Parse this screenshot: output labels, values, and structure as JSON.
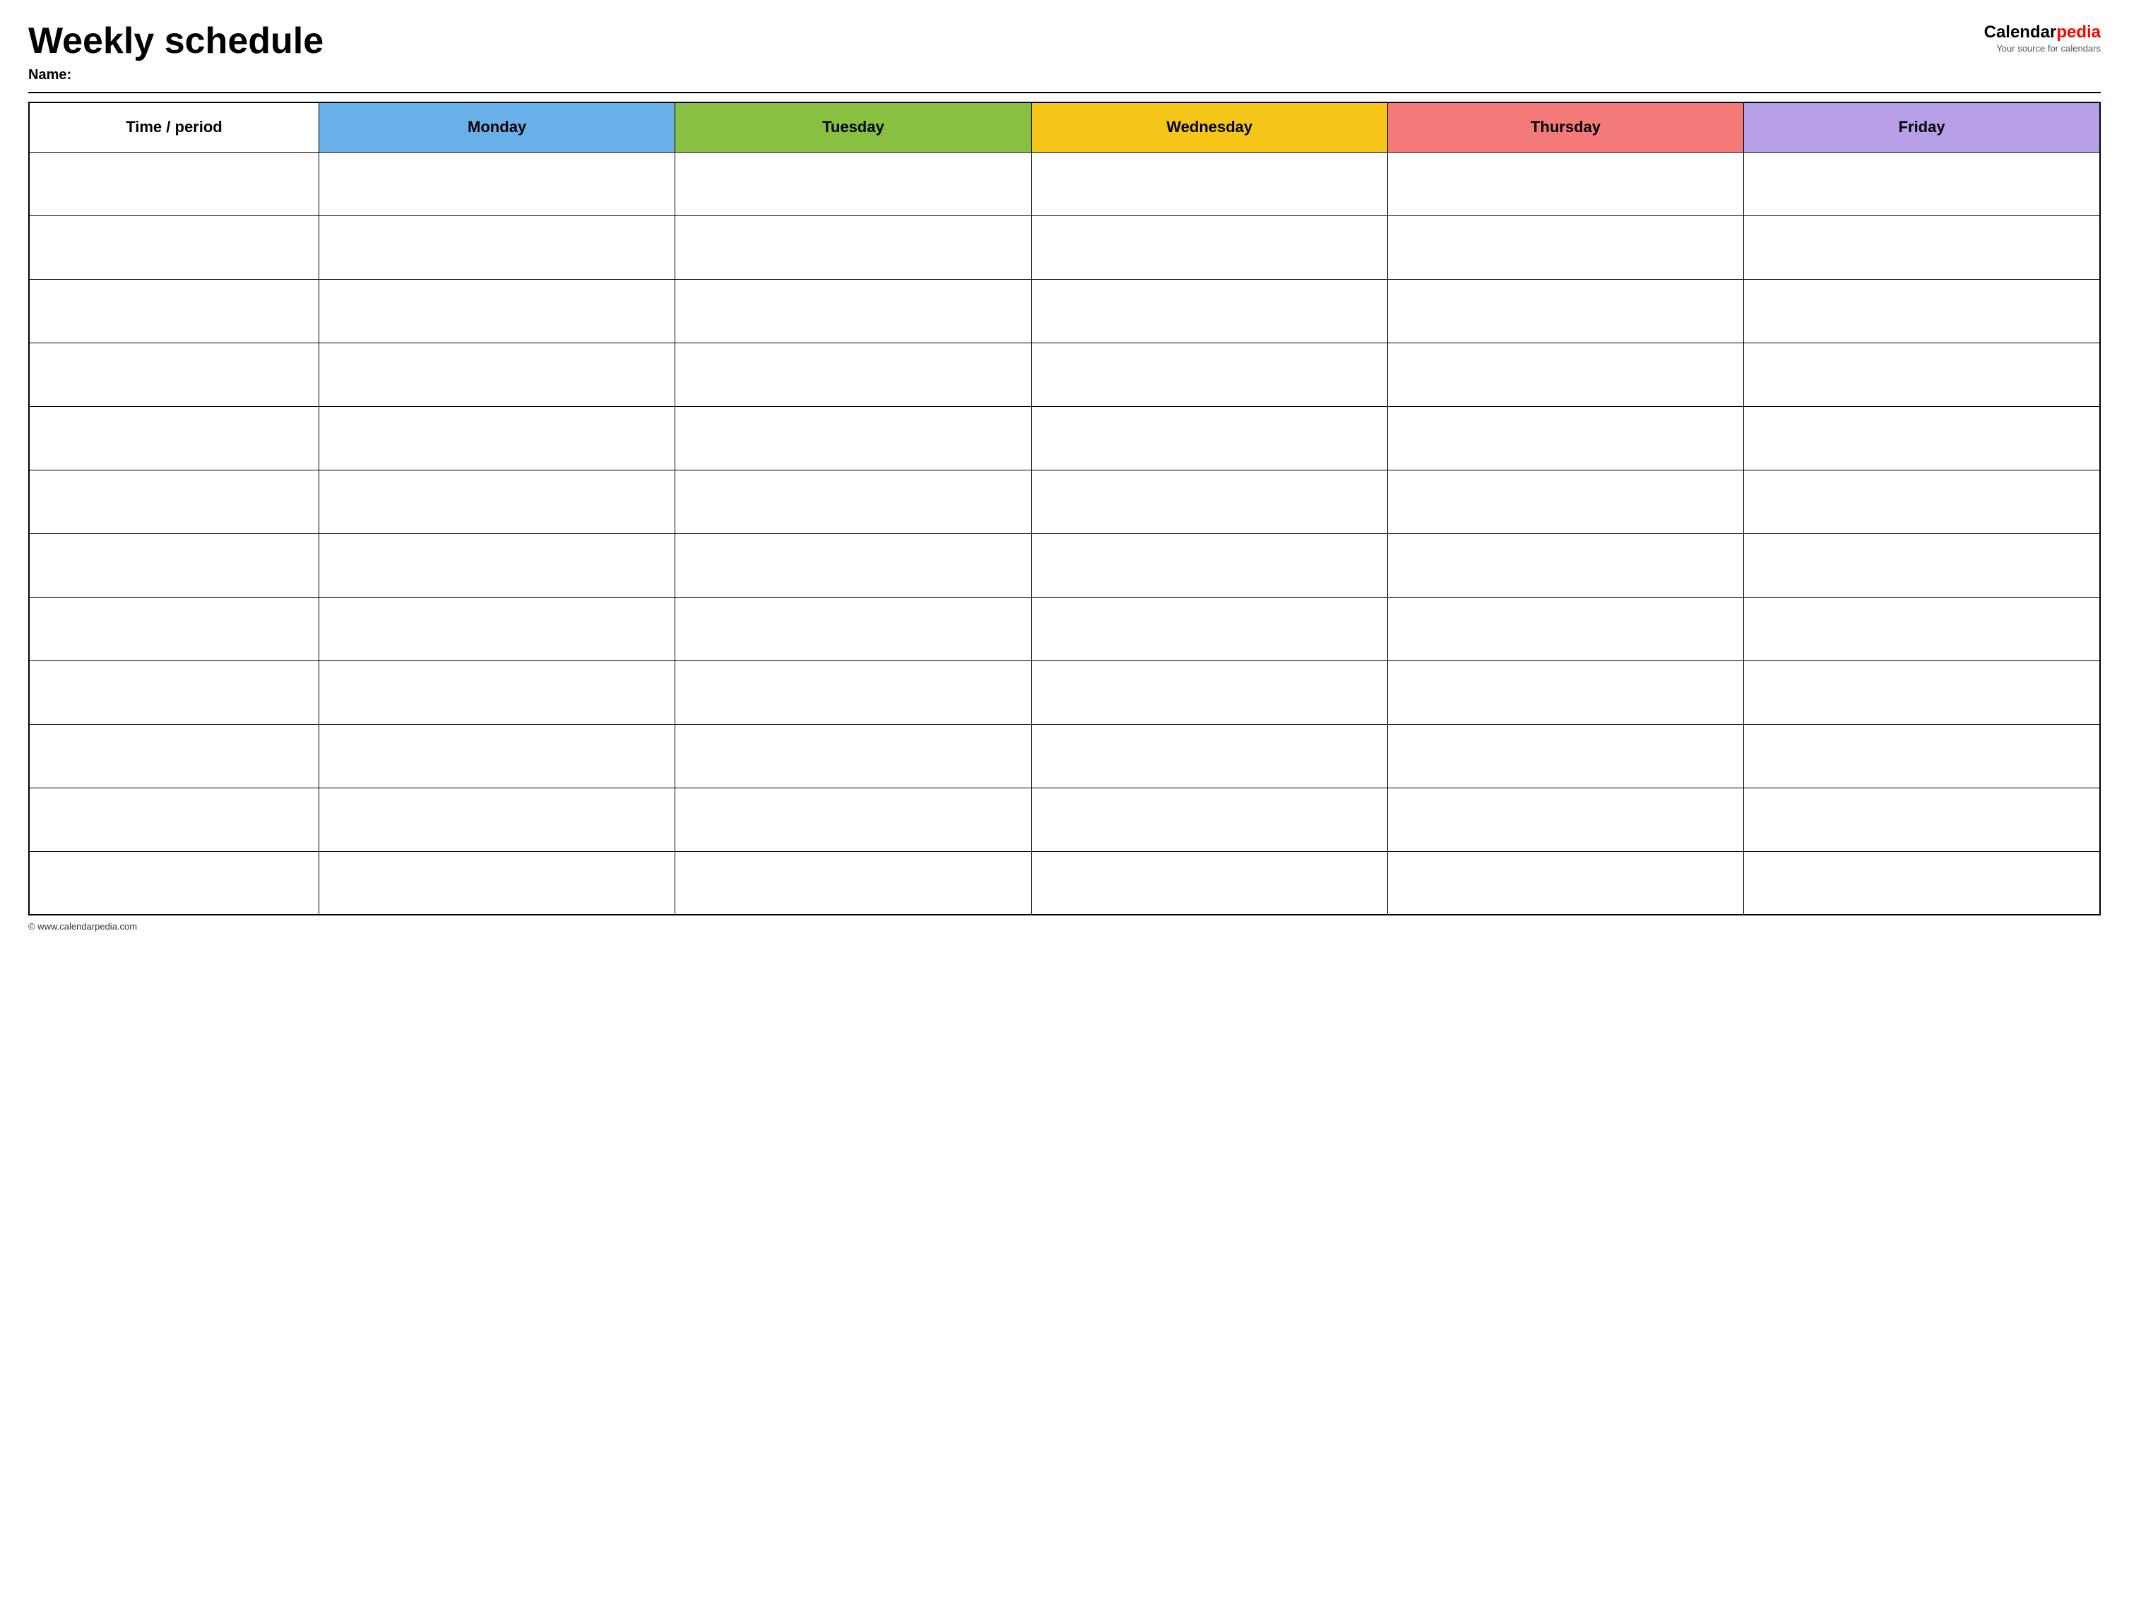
{
  "header": {
    "title": "Weekly schedule",
    "name_label": "Name:",
    "logo": {
      "calendar_text": "Calendar",
      "pedia_text": "pedia",
      "tagline": "Your source for calendars"
    }
  },
  "table": {
    "columns": [
      {
        "id": "time",
        "label": "Time / period",
        "color": "#ffffff"
      },
      {
        "id": "monday",
        "label": "Monday",
        "color": "#6ab0e8"
      },
      {
        "id": "tuesday",
        "label": "Tuesday",
        "color": "#88c041"
      },
      {
        "id": "wednesday",
        "label": "Wednesday",
        "color": "#f5c518"
      },
      {
        "id": "thursday",
        "label": "Thursday",
        "color": "#f47a7a"
      },
      {
        "id": "friday",
        "label": "Friday",
        "color": "#b8a0e8"
      }
    ],
    "row_count": 12
  },
  "footer": {
    "text": "© www.calendarpedia.com"
  }
}
